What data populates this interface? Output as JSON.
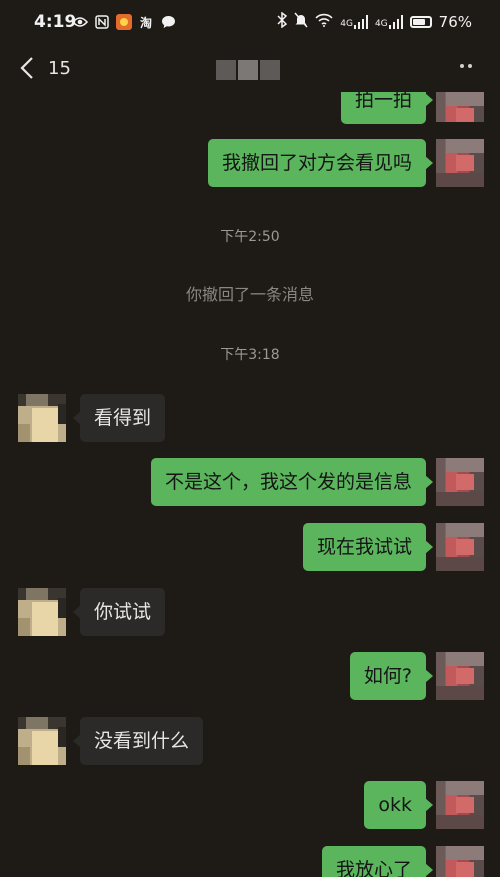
{
  "status_bar": {
    "time": "4:19",
    "signal_left": "4G",
    "signal_right": "4G",
    "battery": "76%",
    "battery_level": 0.76,
    "icons_left": [
      "eye-icon",
      "nfc-icon",
      "app-badge-icon",
      "taobao-icon",
      "chat-bubble-icon"
    ],
    "icons_right": [
      "bluetooth-icon",
      "mute-icon",
      "wifi-icon",
      "signal-icon",
      "signal-icon",
      "battery-icon"
    ],
    "taobao_glyph": "淘"
  },
  "nav": {
    "unread_count": "15",
    "title_hidden": true
  },
  "messages": [
    {
      "side": "me",
      "text": "拍一拍"
    },
    {
      "side": "me",
      "text": "我撤回了对方会看见吗"
    },
    {
      "side": "system",
      "text": "下午2:50"
    },
    {
      "side": "system",
      "text": "你撤回了一条消息"
    },
    {
      "side": "system",
      "text": "下午3:18"
    },
    {
      "side": "them",
      "text": "看得到"
    },
    {
      "side": "me",
      "text": "不是这个，我这个发的是信息"
    },
    {
      "side": "me",
      "text": "现在我试试"
    },
    {
      "side": "them",
      "text": "你试试"
    },
    {
      "side": "me",
      "text": "如何?"
    },
    {
      "side": "them",
      "text": "没看到什么"
    },
    {
      "side": "me",
      "text": "okk"
    },
    {
      "side": "me",
      "text": "我放心了"
    }
  ],
  "colors": {
    "background": "#1e1a15",
    "my_bubble": "#5ab55d",
    "their_bubble": "#2c2a28"
  }
}
